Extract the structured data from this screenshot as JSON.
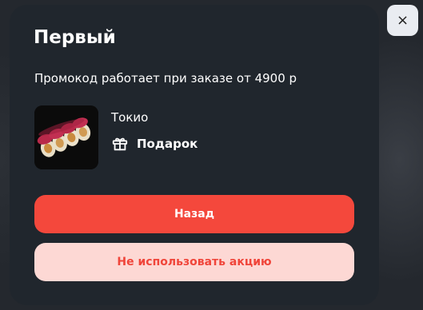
{
  "modal": {
    "title": "Первый",
    "subtitle": "Промокод работает при заказе от 4900 р",
    "product": {
      "name": "Токио",
      "gift_label": "Подарок",
      "gift_icon": "gift-icon",
      "image": "sushi-roll-image"
    },
    "buttons": {
      "back": "Назад",
      "decline": "Не использовать акцию"
    }
  },
  "close_button": {
    "symbol": "×",
    "icon": "close-icon"
  },
  "colors": {
    "modal_bg": "#20262d",
    "primary": "#f4483c",
    "secondary_bg": "#fdd8d4",
    "secondary_text": "#f0453a",
    "close_bg": "#e9ecf1"
  }
}
